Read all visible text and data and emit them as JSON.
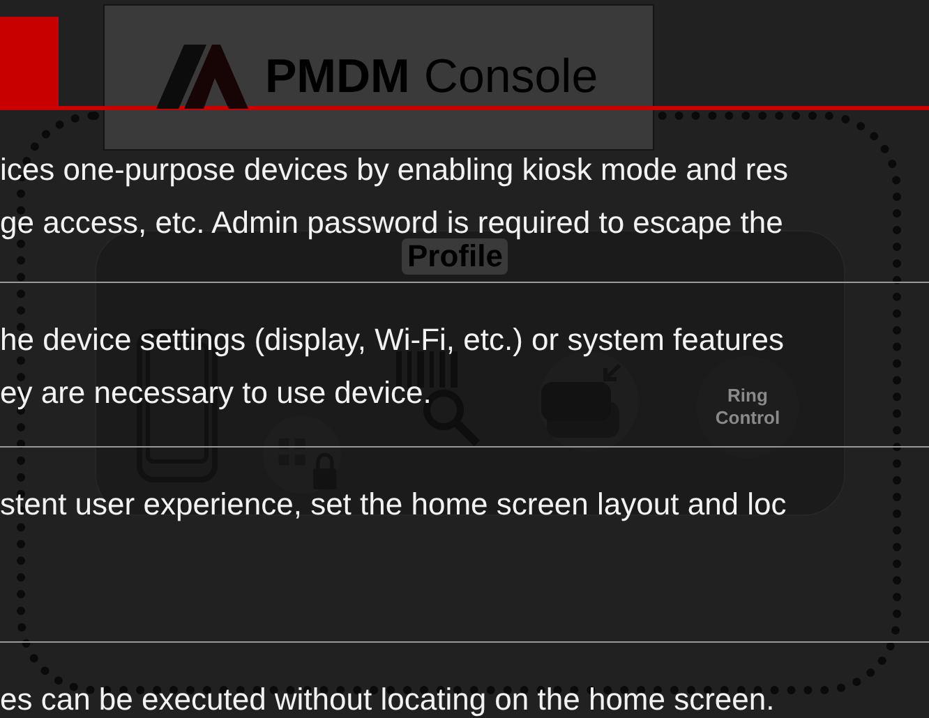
{
  "header": {
    "logo": {
      "brand": "PMDM",
      "product": "Console"
    }
  },
  "artwork": {
    "card_title": "Profile",
    "ring_label": "Ring Control"
  },
  "sections": [
    {
      "lines": [
        "ices one-purpose devices by enabling kiosk mode and res",
        "ge access, etc. Admin password is required to escape the"
      ]
    },
    {
      "lines": [
        "he device settings (display, Wi-Fi, etc.) or system features",
        "ey are necessary to use device."
      ]
    },
    {
      "lines": [
        "stent user experience, set the home screen layout and loc"
      ]
    },
    {
      "lines": [
        "es can be executed without locating on the home screen."
      ]
    }
  ]
}
